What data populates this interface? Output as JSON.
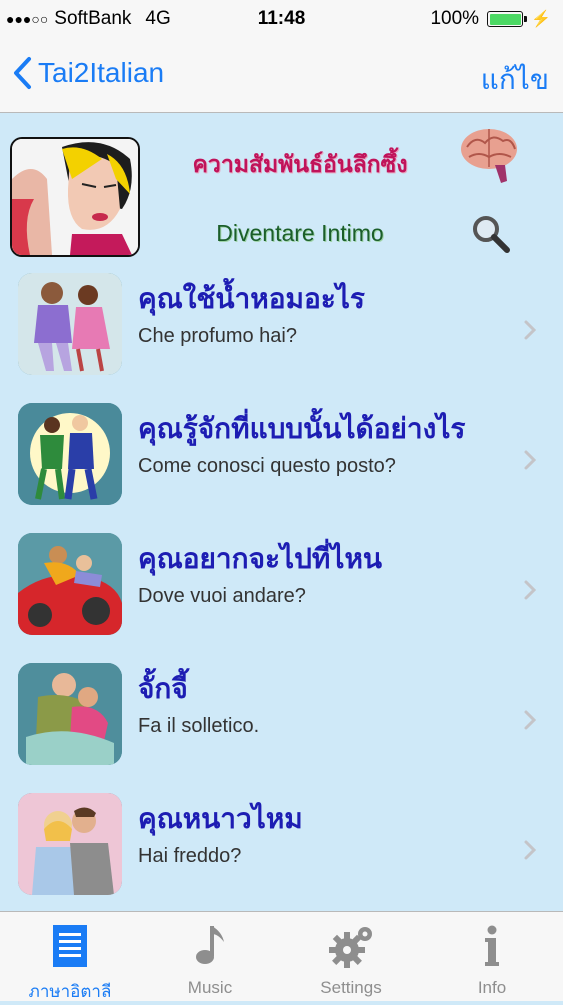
{
  "status": {
    "carrier": "SoftBank",
    "network": "4G",
    "time": "11:48",
    "battery": "100%",
    "battery_color": "#4cd964"
  },
  "nav": {
    "back_label": "Tai2Italian",
    "edit_label": "แก้ไข",
    "accent": "#1a7cf5"
  },
  "header": {
    "thai_title": "ความสัมพันธ์อันลึกซึ้ง",
    "italian_title": "Diventare Intimo",
    "category_icon": "couple-illustration",
    "brain_icon": "brain-icon",
    "search_icon": "search-icon"
  },
  "phrases": [
    {
      "thai": "คุณใช้น้ำหอมอะไร",
      "italian": "Che profumo hai?",
      "thumb": "couple-hugging-illustration"
    },
    {
      "thai": "คุณรู้จักที่แบบนั้นได้อย่างไร",
      "italian": "Come conosci questo posto?",
      "thumb": "couple-walking-illustration"
    },
    {
      "thai": "คุณอยากจะไปที่ไหน",
      "italian": "Dove vuoi andare?",
      "thumb": "couple-in-car-illustration"
    },
    {
      "thai": "จั้กจี้",
      "italian": "Fa il solletico.",
      "thumb": "tickling-illustration"
    },
    {
      "thai": "คุณหนาวไหม",
      "italian": "Hai freddo?",
      "thumb": "couple-embrace-illustration"
    }
  ],
  "tabs": [
    {
      "label": "ภาษาอิตาลี",
      "icon": "document-list-icon",
      "active": true
    },
    {
      "label": "Music",
      "icon": "music-note-icon",
      "active": false
    },
    {
      "label": "Settings",
      "icon": "gear-icon",
      "active": false
    },
    {
      "label": "Info",
      "icon": "info-icon",
      "active": false
    }
  ]
}
